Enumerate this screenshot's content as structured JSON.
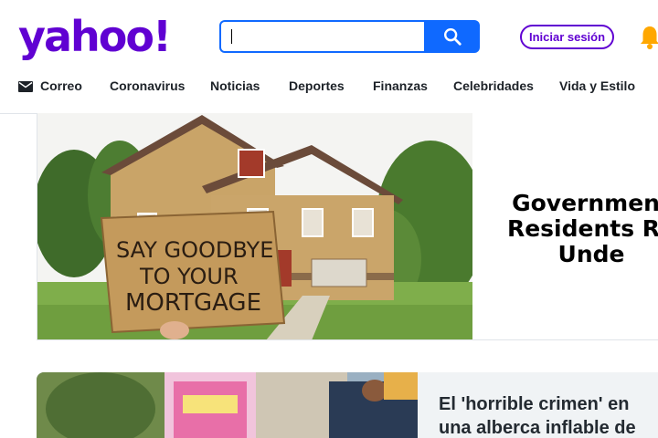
{
  "logo": {
    "text": "yahoo!"
  },
  "search": {
    "placeholder": "",
    "value": ""
  },
  "header": {
    "signin_label": "Iniciar sesión"
  },
  "nav": {
    "items": [
      "Correo",
      "Coronavirus",
      "Noticias",
      "Deportes",
      "Finanzas",
      "Celebridades",
      "Vida y Estilo"
    ]
  },
  "card1": {
    "sign_lines": [
      "SAY GOODBYE",
      "TO YOUR",
      "MORTGAGE"
    ],
    "title_lines": [
      "Government",
      "Residents Re",
      "Unde"
    ]
  },
  "card2": {
    "title_lines": [
      "El 'horrible crimen' en",
      "una alberca inflable de"
    ]
  },
  "colors": {
    "brand": "#6001d2",
    "search_blue": "#0f69ff",
    "bell": "#ffa700"
  }
}
